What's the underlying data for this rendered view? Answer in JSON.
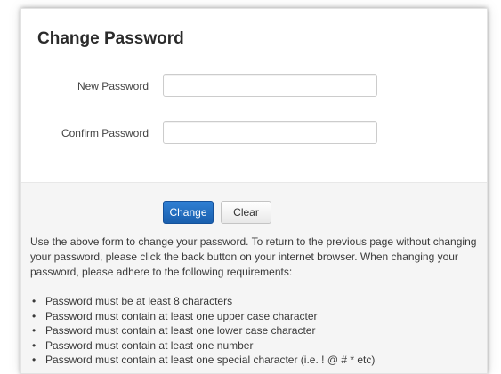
{
  "title": "Change Password",
  "form": {
    "new_password": {
      "label": "New Password",
      "value": ""
    },
    "confirm_password": {
      "label": "Confirm Password",
      "value": ""
    }
  },
  "buttons": {
    "change": "Change",
    "clear": "Clear"
  },
  "instructions": "Use the above form to change your password. To return to the previous page without changing your password, please click the back button on your internet browser. When changing your password, please adhere to the following requirements:",
  "requirements": [
    "Password must be at least 8 characters",
    "Password must contain at least one upper case character",
    "Password must contain at least one lower case character",
    "Password must contain at least one number",
    "Password must contain at least one special character (i.e. ! @ # * etc)"
  ],
  "colors": {
    "primary_button": "#1f6bbd",
    "footer_background": "#f5f5f5"
  }
}
